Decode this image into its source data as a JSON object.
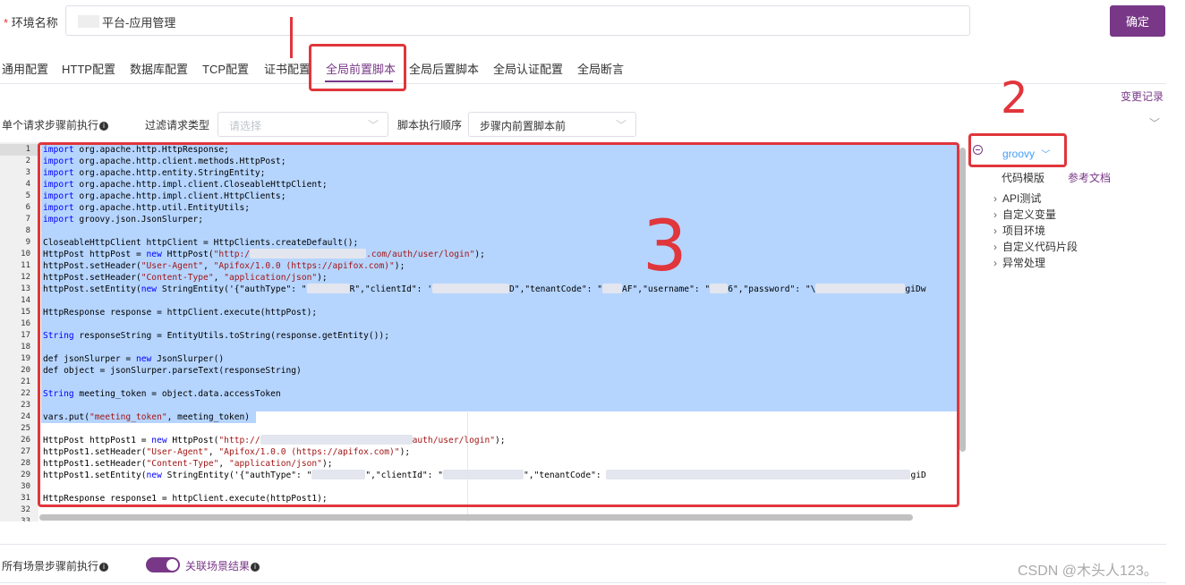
{
  "env": {
    "required_mark": "*",
    "label": "环境名称",
    "value": "平台-应用管理",
    "confirm": "确定"
  },
  "tabs": [
    {
      "label": "通用配置"
    },
    {
      "label": "HTTP配置"
    },
    {
      "label": "数据库配置"
    },
    {
      "label": "TCP配置"
    },
    {
      "label": "证书配置"
    },
    {
      "label": "全局前置脚本"
    },
    {
      "label": "全局后置脚本"
    },
    {
      "label": "全局认证配置"
    },
    {
      "label": "全局断言"
    }
  ],
  "active_tab": "全局前置脚本",
  "change_log": "变更记录",
  "filters": {
    "single_step": "单个请求步骤前执行",
    "filter_label": "过滤请求类型",
    "filter_placeholder": "请选择",
    "order_label": "脚本执行顺序",
    "order_value": "步骤内前置脚本前"
  },
  "editor": {
    "line_numbers": [
      "1",
      "2",
      "3",
      "4",
      "5",
      "6",
      "7",
      "8",
      "9",
      "10",
      "11",
      "12",
      "13",
      "14",
      "15",
      "16",
      "17",
      "18",
      "19",
      "20",
      "21",
      "22",
      "23",
      "24",
      "25",
      "26",
      "27",
      "28",
      "29",
      "30",
      "31",
      "32",
      "33"
    ]
  },
  "code": {
    "l1b": " org.apache.http.HttpResponse;",
    "l2b": " org.apache.http.client.methods.HttpPost;",
    "l3b": " org.apache.http.entity.StringEntity;",
    "l4b": " org.apache.http.impl.client.CloseableHttpClient;",
    "l5b": " org.apache.http.impl.client.HttpClients;",
    "l6b": " org.apache.http.util.EntityUtils;",
    "l7b": " groovy.json.JsonSlurper;",
    "kw_import": "import",
    "kw_new": "new",
    "kw_String": "String",
    "l9": "CloseableHttpClient httpClient = HttpClients.createDefault();",
    "l10a": "HttpPost httpPost = ",
    "l10b": " HttpPost(",
    "l10c": "\"http:/",
    "l10d": ".com/auth/user/login\"",
    "l10e": ");",
    "l11a": "httpPost.setHeader(",
    "l11b": "\"User-Agent\"",
    "l11c": ", ",
    "l11d": "\"Apifox/1.0.0 (https://apifox.com)\"",
    "l11e": ");",
    "l12a": "httpPost.setHeader(",
    "l12b": "\"Content-Type\"",
    "l12c": ", ",
    "l12d": "\"application/json\"",
    "l12e": ");",
    "l13a": "httpPost.setEntity(",
    "l13b": " StringEntity('{\"authType\": \"",
    "l13c": "R\",\"clientId\": '",
    "l13d": "D\",\"tenantCode\": \"",
    "l13e": "AF\",\"username\": \"",
    "l13f": "6\",\"password\": \"\\",
    "l13g": "giDw",
    "l15": "HttpResponse response = httpClient.execute(httpPost);",
    "l17b": " responseString = EntityUtils.toString(response.getEntity());",
    "l19a": "def jsonSlurper = ",
    "l19b": " JsonSlurper()",
    "l20": "def object = jsonSlurper.parseText(responseString)",
    "l22b": " meeting_token = object.data.accessToken",
    "l24a": "vars.put(",
    "l24b": "\"meeting_token\"",
    "l24c": ", meeting_token)",
    "l26a": "HttpPost httpPost1 = ",
    "l26b": " HttpPost(",
    "l26c": "\"http://",
    "l26d": "auth/user/login\"",
    "l26e": ");",
    "l27a": "httpPost1.setHeader(",
    "l27b": "\"User-Agent\"",
    "l27c": ", ",
    "l27d": "\"Apifox/1.0.0 (https://apifox.com)\"",
    "l27e": ");",
    "l28a": "httpPost1.setHeader(",
    "l28b": "\"Content-Type\"",
    "l28c": ", ",
    "l28d": "\"application/json\"",
    "l28e": ");",
    "l29a": "httpPost1.setEntity(",
    "l29b": " StringEntity('{\"authType\": \"",
    "l29c": "\",\"clientId\": \"",
    "l29d": "\",\"tenantCode\": ",
    "l29e": "giD",
    "l31": "HttpResponse response1 = httpClient.execute(httpPost1);"
  },
  "side": {
    "language": "groovy",
    "template": "代码模版",
    "docs": "参考文档",
    "items": [
      {
        "label": "API测试"
      },
      {
        "label": "自定义变量"
      },
      {
        "label": "项目环境"
      },
      {
        "label": "自定义代码片段"
      },
      {
        "label": "异常处理"
      }
    ]
  },
  "bottom": {
    "all_scenario": "所有场景步骤前执行",
    "related_results": "关联场景结果"
  },
  "watermark": "CSDN @木头人123。",
  "annotations": {
    "n2": "2",
    "n3": "3"
  },
  "colors": {
    "accent": "#783887",
    "highlight": "#e0363c",
    "selection": "#b5d5ff"
  }
}
